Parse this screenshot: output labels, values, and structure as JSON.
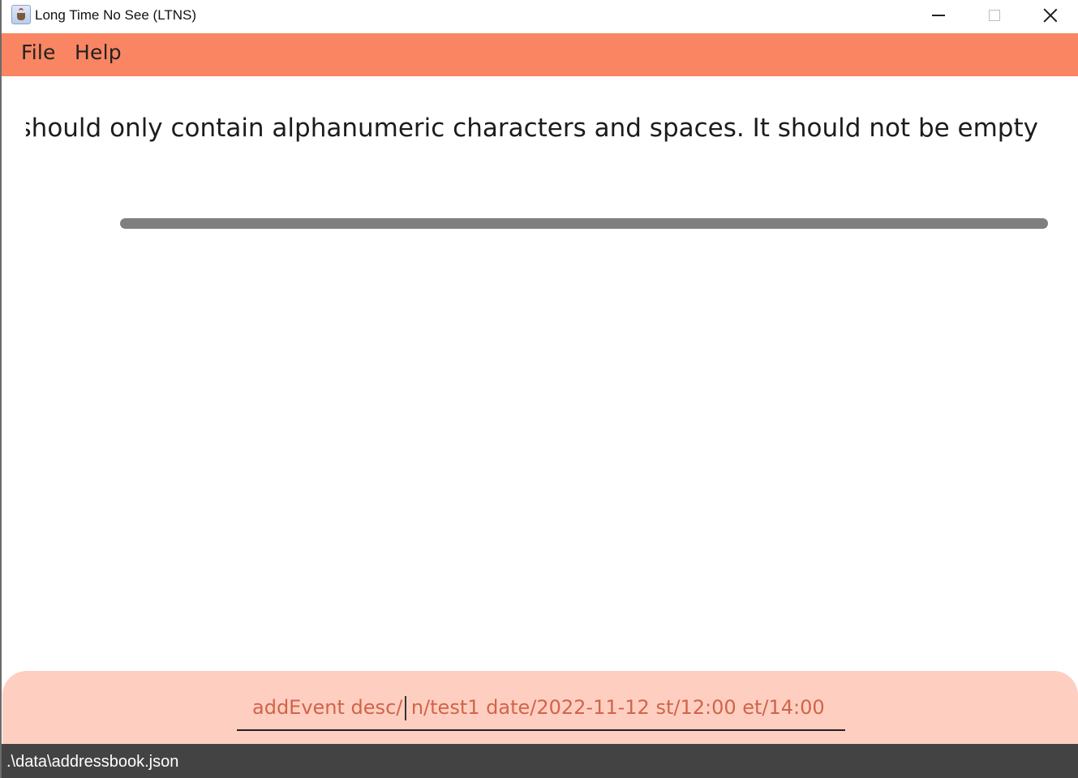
{
  "window": {
    "title": "Long Time No See (LTNS)",
    "icon": "app-coffee-icon"
  },
  "menu": {
    "items": [
      {
        "label": "File"
      },
      {
        "label": "Help"
      }
    ]
  },
  "result": {
    "text": "ption should only contain alphanumeric characters and spaces. It should not be empty"
  },
  "command": {
    "before_caret": "addEvent desc/",
    "after_caret": "n/test1 date/2022-11-12 st/12:00 et/14:00"
  },
  "status": {
    "path": ".\\data\\addressbook.json"
  },
  "colors": {
    "menubar": "#f98562",
    "command_panel": "#fecfc1",
    "command_text": "#d2634a",
    "statusbar": "#434343"
  }
}
